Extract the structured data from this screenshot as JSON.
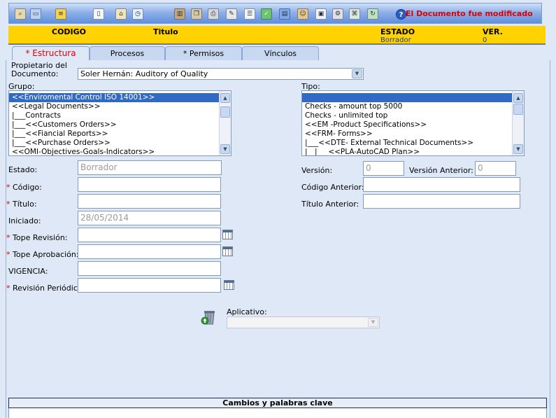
{
  "toolbar": {
    "icons": [
      "search-icon",
      "preview-icon",
      "notes-icon",
      "document-icon",
      "home-icon",
      "history-icon",
      "books-icon",
      "copy-icon",
      "print-icon",
      "edit-icon",
      "text-icon",
      "check-icon",
      "doc-blue-icon",
      "users-icon",
      "card-icon",
      "settings-icon",
      "attach-icon",
      "refresh-icon"
    ],
    "help_glyph": "?",
    "message": "El Documento fue modificado"
  },
  "header": {
    "codigo_label": "CODIGO",
    "titulo_label": "Titulo",
    "estado_label": "ESTADO",
    "estado_value": "Borrador",
    "ver_label": "VER.",
    "ver_value": "0"
  },
  "tabs": [
    {
      "label": "* Estructura",
      "active": true
    },
    {
      "label": "Procesos",
      "active": false
    },
    {
      "label": "* Permisos",
      "active": false
    },
    {
      "label": "Vínculos",
      "active": false
    }
  ],
  "form": {
    "propietario_label_1": "Propietario del",
    "propietario_label_2": "Documento:",
    "propietario_value": "Soler Hernán: Auditory of Quality",
    "grupo_label": "Grupo:",
    "grupo_items": [
      "<<Enviromental Control ISO 14001>>",
      "<<Legal Documents>>",
      "|___Contracts",
      "|___<<Customers Orders>>",
      "|___<<Fiancial Reports>>",
      "|___<<Purchase Orders>>",
      "<<OMI-Objectives-Goals-Indicators>>"
    ],
    "tipo_label": "Tipo:",
    "tipo_items": [
      "",
      "Checks - amount top 5000",
      "Checks - unlimited top",
      "<<EM -Product Specifications>>",
      "<<FRM- Forms>>",
      "|___<<DTE- External Technical Documents>>",
      "|__|___<<PLA-AutoCAD Plan>>"
    ],
    "estado_label": "Estado:",
    "estado_value": "Borrador",
    "codigo_label": "Código:",
    "titulo_label": "Título:",
    "iniciado_label": "Iniciado:",
    "iniciado_value": "28/05/2014",
    "tope_revision_label": "Tope Revisión:",
    "tope_aprobacion_label": "Tope Aprobación:",
    "vigencia_label": "VIGENCIA:",
    "revision_periodica_label": "Revisión Periódica:",
    "version_label": "Versión:",
    "version_value": "0",
    "version_anterior_label": "Versión Anterior:",
    "version_anterior_value": "0",
    "codigo_anterior_label": "Código Anterior:",
    "titulo_anterior_label": "Título Anterior:",
    "aplicativo_label": "Aplicativo:",
    "required_mark": "*"
  },
  "footer": {
    "cambios_label": "Cambios y palabras clave"
  },
  "colors": {
    "header_yellow": "#ffd200",
    "alert_red": "#e00000",
    "panel_bg": "#dfe8f6",
    "selection_blue": "#316ac5"
  }
}
